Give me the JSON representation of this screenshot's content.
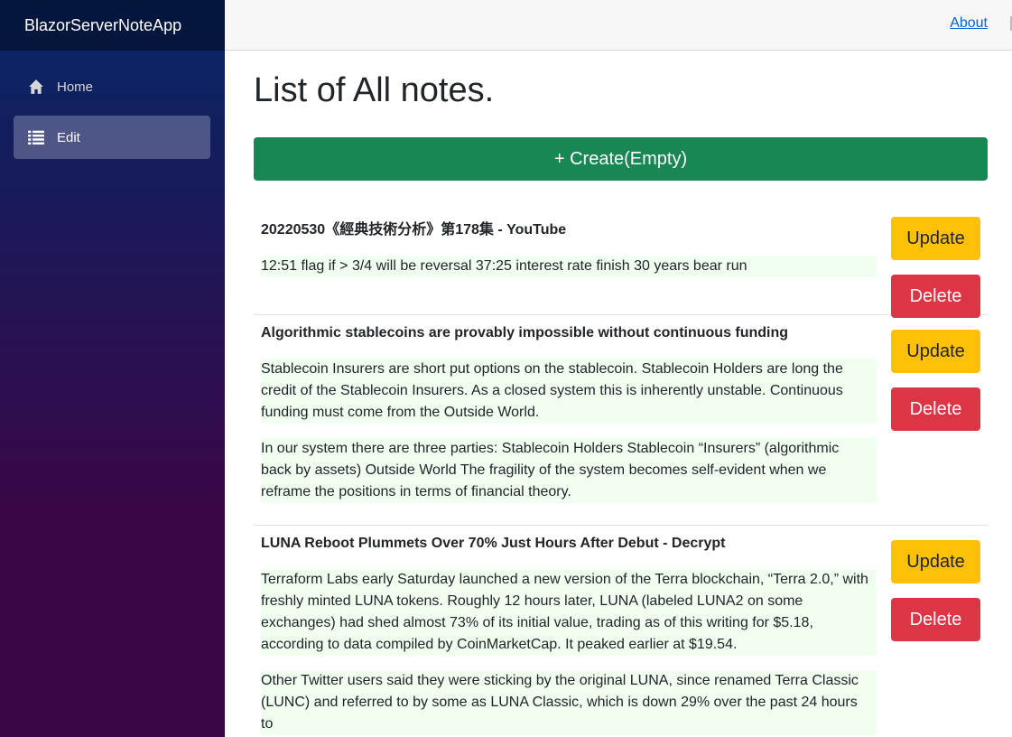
{
  "app": {
    "brand": "BlazorServerNoteApp"
  },
  "nav": {
    "items": [
      {
        "label": "Home",
        "icon": "home-icon",
        "active": false
      },
      {
        "label": "Edit",
        "icon": "list-icon",
        "active": true
      }
    ]
  },
  "top_row": {
    "about_label": "About"
  },
  "page": {
    "title": "List of All notes.",
    "create_label": "+ Create(Empty)",
    "update_label": "Update",
    "delete_label": "Delete"
  },
  "notes": [
    {
      "title": "20220530《經典技術分析》第178集 - YouTube",
      "paragraphs": [
        "12:51 flag if > 3/4 will be reversal 37:25 interest rate finish 30 years bear run"
      ]
    },
    {
      "title": "Algorithmic stablecoins are provably impossible without continuous funding",
      "paragraphs": [
        "Stablecoin Insurers are short put options on the stablecoin. Stablecoin Holders are long the credit of the Stablecoin Insurers. As a closed system this is inherently unstable. Continuous funding must come from the Outside World.",
        "In our system there are three parties: Stablecoin Holders Stablecoin “Insurers” (algorithmic back by assets) Outside World The fragility of the system becomes self-evident when we reframe the positions in terms of financial theory."
      ]
    },
    {
      "title": "LUNA Reboot Plummets Over 70% Just Hours After Debut - Decrypt",
      "paragraphs": [
        "Terraform Labs early Saturday launched a new version of the Terra blockchain, “Terra 2.0,” with freshly minted LUNA tokens. Roughly 12 hours later, LUNA (labeled LUNA2 on some exchanges) had shed almost 73% of its initial value, trading as of this writing for $5.18, according to data compiled by CoinMarketCap. It peaked earlier at $19.54.",
        "Other Twitter users said they were sticking by the original LUNA, since renamed Terra Classic (LUNC) and referred to by some as LUNA Classic, which is down 29% over the past 24 hours to"
      ]
    }
  ],
  "colors": {
    "create": "#198754",
    "update": "#ffc107",
    "delete": "#dc3545",
    "paragraph_bg": "#f0fff0",
    "link": "#0366d6"
  }
}
